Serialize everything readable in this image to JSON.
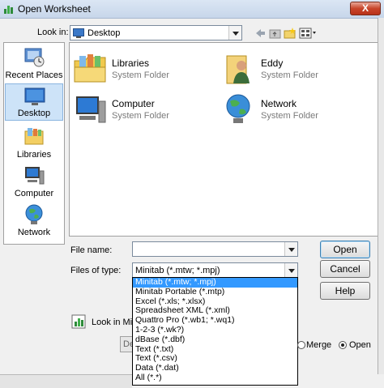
{
  "window": {
    "title": "Open Worksheet",
    "close_label": "X"
  },
  "lookin": {
    "label": "Look in:",
    "value": "Desktop"
  },
  "places": [
    {
      "label": "Recent Places",
      "icon": "recent-places-icon"
    },
    {
      "label": "Desktop",
      "icon": "desktop-icon"
    },
    {
      "label": "Libraries",
      "icon": "libraries-icon"
    },
    {
      "label": "Computer",
      "icon": "computer-icon"
    },
    {
      "label": "Network",
      "icon": "network-icon"
    }
  ],
  "files": [
    {
      "name": "Libraries",
      "type": "System Folder",
      "icon": "libraries-folder-icon"
    },
    {
      "name": "Eddy",
      "type": "System Folder",
      "icon": "user-folder-icon"
    },
    {
      "name": "Computer",
      "type": "System Folder",
      "icon": "computer-icon"
    },
    {
      "name": "Network",
      "type": "System Folder",
      "icon": "network-icon"
    }
  ],
  "filename": {
    "label": "File name:",
    "value": ""
  },
  "filetype": {
    "label": "Files of type:",
    "selected": "Minitab (*.mtw; *.mpj)",
    "options": [
      "Minitab (*.mtw; *.mpj)",
      "Minitab Portable (*.mtp)",
      "Excel (*.xls; *.xlsx)",
      "Spreadsheet XML (*.xml)",
      "Quattro Pro (*.wb1; *.wq1)",
      "1-2-3 (*.wk?)",
      "dBase (*.dbf)",
      "Text (*.txt)",
      "Text (*.csv)",
      "Data (*.dat)",
      "All (*.*)"
    ]
  },
  "buttons": {
    "open": "Open",
    "cancel": "Cancel",
    "help": "Help"
  },
  "lookin_minitab": {
    "label": "Look in Minita"
  },
  "partial_button": {
    "label": "De"
  },
  "merge": {
    "merge_label": "Merge",
    "open_label": "Open",
    "selected": "Open"
  },
  "colors": {
    "accent": "#3399ff",
    "titlebar": "#c7d6ea",
    "close": "#c8452a"
  }
}
